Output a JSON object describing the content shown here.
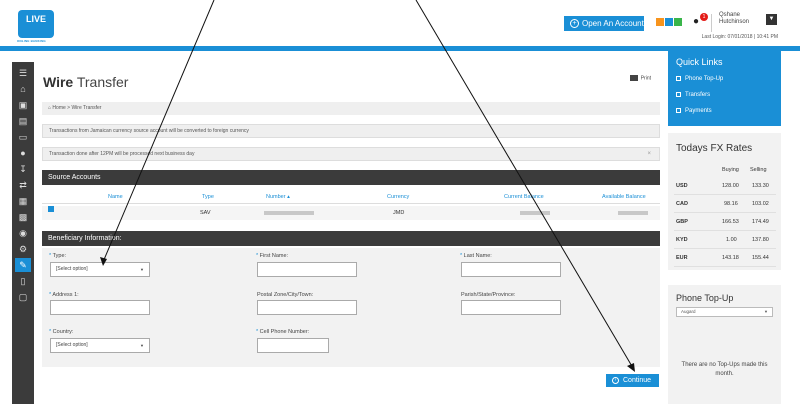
{
  "header": {
    "logo_text": "LIVE",
    "logo_subtext": "ONLINE BANKING",
    "open_account_label": "Open An Account",
    "gift_badge": "1",
    "user_name_line1": "Qshane",
    "user_name_line2": "Hutchinson",
    "last_login": "Last Login: 07/01/2018 | 10:41 PM",
    "accent_color": "#1a8fd6",
    "squares": [
      "#f7941d",
      "#1a8fd6",
      "#39b54a",
      "#39b54a"
    ]
  },
  "page": {
    "title_bold": "Wire",
    "title_light": "Transfer",
    "print_label": "Print",
    "breadcrumb": "Home > Wire Transfer",
    "notice1": "Transactions from Jamaican currency source account will be converted to foreign currency",
    "notice2": "Transaction done after 12PM will be processed next business day"
  },
  "source_accounts": {
    "title": "Source Accounts",
    "columns": [
      "Name",
      "Type",
      "Number ▴",
      "Currency",
      "Current Balance",
      "Available Balance"
    ],
    "row": {
      "type": "SAV",
      "currency": "JMD"
    }
  },
  "beneficiary": {
    "title": "Beneficiary Information:",
    "type_label": "Type:",
    "type_value": "[Select option]",
    "first_name_label": "First Name:",
    "last_name_label": "Last Name:",
    "address_label": "Address 1:",
    "postal_label": "Postal Zone/City/Town:",
    "parish_label": "Parish/State/Province:",
    "country_label": "Country:",
    "country_value": "[Select option]",
    "cell_label": "Cell Phone Number:"
  },
  "continue_label": "Continue",
  "quick_links": {
    "title": "Quick Links",
    "items": [
      "Phone Top-Up",
      "Transfers",
      "Payments"
    ]
  },
  "fx": {
    "title": "Todays FX Rates",
    "headers": [
      "Buying",
      "Selling"
    ],
    "rows": [
      {
        "cur": "USD",
        "buy": "128.00",
        "sell": "133.30"
      },
      {
        "cur": "CAD",
        "buy": "98.16",
        "sell": "103.02"
      },
      {
        "cur": "GBP",
        "buy": "166.53",
        "sell": "174.49"
      },
      {
        "cur": "KYD",
        "buy": "1.00",
        "sell": "137.80"
      },
      {
        "cur": "EUR",
        "buy": "143.18",
        "sell": "155.44"
      }
    ]
  },
  "phone_topup": {
    "title": "Phone Top-Up",
    "select_value": "Augard",
    "message": "There are no Top-Ups made this month."
  }
}
